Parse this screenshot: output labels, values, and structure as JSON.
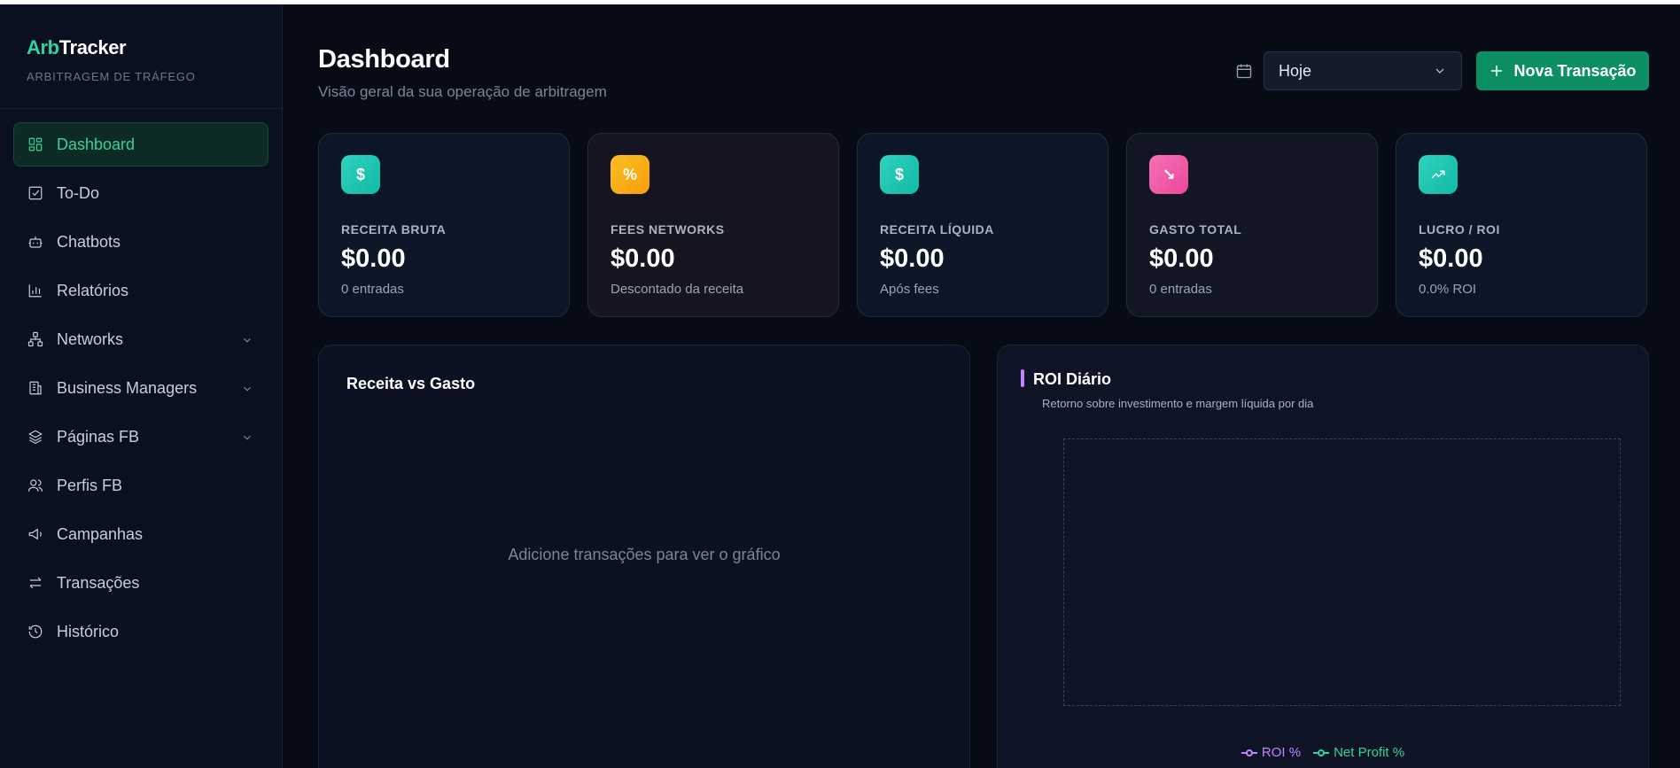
{
  "brand": {
    "logo_part1": "Arb",
    "logo_part2": "Tracker",
    "subtitle": "ARBITRAGEM DE TRÁFEGO"
  },
  "sidebar": {
    "items": [
      {
        "label": "Dashboard",
        "icon": "grid-icon",
        "active": true
      },
      {
        "label": "To-Do",
        "icon": "checkbox-icon"
      },
      {
        "label": "Chatbots",
        "icon": "bot-icon"
      },
      {
        "label": "Relatórios",
        "icon": "bar-chart-icon"
      },
      {
        "label": "Networks",
        "icon": "network-icon",
        "expandable": true
      },
      {
        "label": "Business Managers",
        "icon": "building-icon",
        "expandable": true
      },
      {
        "label": "Páginas FB",
        "icon": "layers-icon",
        "expandable": true
      },
      {
        "label": "Perfis FB",
        "icon": "users-icon"
      },
      {
        "label": "Campanhas",
        "icon": "megaphone-icon"
      },
      {
        "label": "Transações",
        "icon": "arrows-icon"
      },
      {
        "label": "Histórico",
        "icon": "history-icon"
      }
    ]
  },
  "header": {
    "title": "Dashboard",
    "subtitle": "Visão geral da sua operação de arbitragem",
    "period_select": "Hoje",
    "new_button": "Nova Transação"
  },
  "kpis": [
    {
      "label": "RECEITA BRUTA",
      "value": "$0.00",
      "note": "0 entradas",
      "icon_text": "$",
      "color": "#2dd4bf"
    },
    {
      "label": "FEES NETWORKS",
      "value": "$0.00",
      "note": "Descontado da receita",
      "icon_text": "%",
      "color": "#f59e0b"
    },
    {
      "label": "RECEITA LÍQUIDA",
      "value": "$0.00",
      "note": "Após fees",
      "icon_text": "$",
      "color": "#2dd4bf"
    },
    {
      "label": "GASTO TOTAL",
      "value": "$0.00",
      "note": "0 entradas",
      "icon_text": "↘",
      "color": "#f472b6"
    },
    {
      "label": "LUCRO / ROI",
      "value": "$0.00",
      "note": "0.0% ROI",
      "icon_text": "",
      "color": "#2dd4bf"
    }
  ],
  "charts": {
    "left": {
      "title": "Receita vs Gasto",
      "empty_message": "Adicione transações para ver o gráfico"
    },
    "right": {
      "title": "ROI Diário",
      "subtitle": "Retorno sobre investimento e margem líquida por dia",
      "legend": [
        {
          "name": "ROI %",
          "color": "#c084fc"
        },
        {
          "name": "Net Profit %",
          "color": "#34d399"
        }
      ]
    }
  },
  "chart_data": {
    "type": "line",
    "title": "ROI Diário",
    "series": [
      {
        "name": "ROI %",
        "values": []
      },
      {
        "name": "Net Profit %",
        "values": []
      }
    ],
    "legend": "bottom-center"
  }
}
